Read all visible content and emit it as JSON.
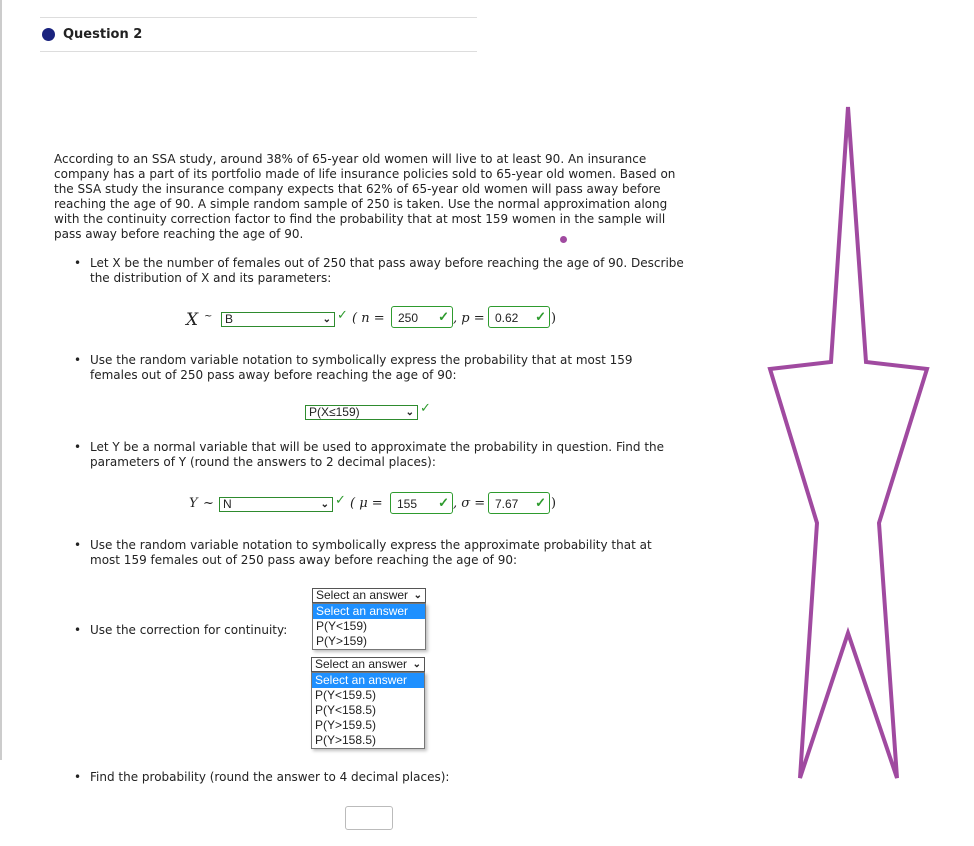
{
  "question": {
    "title": "Question 2"
  },
  "problem": "According to an SSA study, around 38% of 65-year old women will live to at least 90. An insurance company has a part of its portfolio made of life insurance policies sold to 65-year old women. Based on the SSA study the insurance company expects that 62% of 65-year old women will pass away before reaching the age of 90. A simple random sample of 250 is taken. Use the normal approximation along with the continuity correction factor to find the probability that at most 159 women in the sample will pass away before reaching the age of 90.",
  "parts": [
    {
      "text": "Let X  be the number of females out of 250 that pass away before reaching the age of 90. Describe the distribution of X  and its parameters:"
    },
    {
      "text": "Use the random variable notation to symbolically express the probability that at most 159 females out of 250 pass away before reaching the age of 90:"
    },
    {
      "text": "Let Y be a normal variable that will be used to approximate the probability in question. Find the parameters of Y (round the answers to 2 decimal places):"
    },
    {
      "text": "Use the random variable notation to symbolically express the approximate probability that at most 159 females out of 250 pass away before reaching the age of 90:"
    },
    {
      "text": "Use the correction for continuity:"
    },
    {
      "text": "Find the probability (round the answer to 4 decimal places):"
    }
  ],
  "x_dist": {
    "var": "X",
    "tilde": "~",
    "dist": "B",
    "n_label": "( n =",
    "n": "250",
    "p_label": ", p =",
    "p": "0.62",
    "close": ")"
  },
  "x_prob": {
    "value": "P(X≤159)"
  },
  "y_dist": {
    "var": "Y",
    "tilde": "~",
    "dist": "N",
    "mu_label": "( μ =",
    "mu": "155",
    "sigma_label": ", σ =",
    "sigma": "7.67",
    "close": ")"
  },
  "dropdown1": {
    "selected": "Select an answer",
    "options": [
      "Select an answer",
      "P(Y<159)",
      "P(Y>159)"
    ]
  },
  "dropdown2": {
    "selected": "Select an answer",
    "options": [
      "Select an answer",
      "P(Y<159.5)",
      "P(Y<158.5)",
      "P(Y>159.5)",
      "P(Y>158.5)"
    ]
  },
  "answer": {
    "value": ""
  },
  "colors": {
    "correct": "#2e9b2e",
    "highlight": "#1e90ff",
    "drawing": "#a04aa0",
    "question_dot": "#1a237e"
  },
  "icons": {
    "check": "checkmark-icon",
    "chevron": "chevron-down-icon"
  }
}
